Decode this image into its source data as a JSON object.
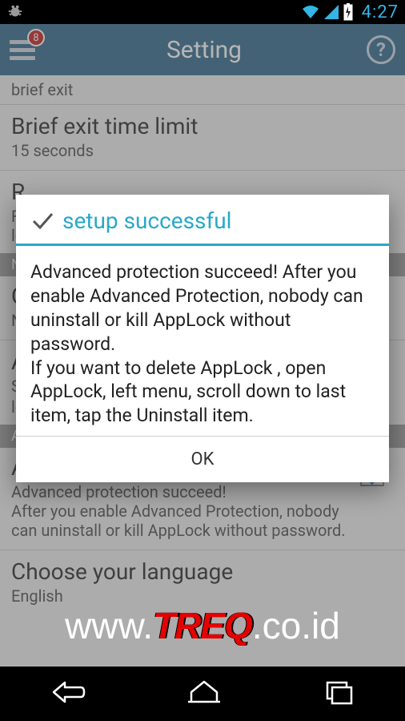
{
  "status": {
    "time": "4:27"
  },
  "actionbar": {
    "title": "Setting",
    "badge": "8"
  },
  "rows": {
    "prev_sub": "brief exit",
    "brief_exit_title": "Brief exit time limit",
    "brief_exit_sub": "15 seconds",
    "relock_title_partial": "R",
    "relock_sub_partial": "F\nlo",
    "section_notif_partial": "No",
    "cover_title_partial": "C",
    "cover_sub_partial": "N",
    "random_title_partial": "A",
    "random_sub1_partial": "S",
    "random_sub2_partial": "lo",
    "section_advanced_partial": "Ad",
    "adv_title": "Advanced Protection",
    "adv_sub": "Advanced protection succeed!\nAfter you enable Advanced Protection, nobody can uninstall or kill AppLock without password.",
    "lang_title": "Choose your language",
    "lang_sub": "English"
  },
  "dialog": {
    "title": "setup successful",
    "body": "Advanced protection succeed! After you enable Advanced Protection, nobody can uninstall or kill AppLock without password.\nIf you want to delete AppLock , open AppLock, left menu, scroll down to last item, tap the Uninstall item.",
    "ok": "OK"
  },
  "watermark": {
    "pre": "www.",
    "brand": "TREQ",
    "post": ".co.id"
  }
}
